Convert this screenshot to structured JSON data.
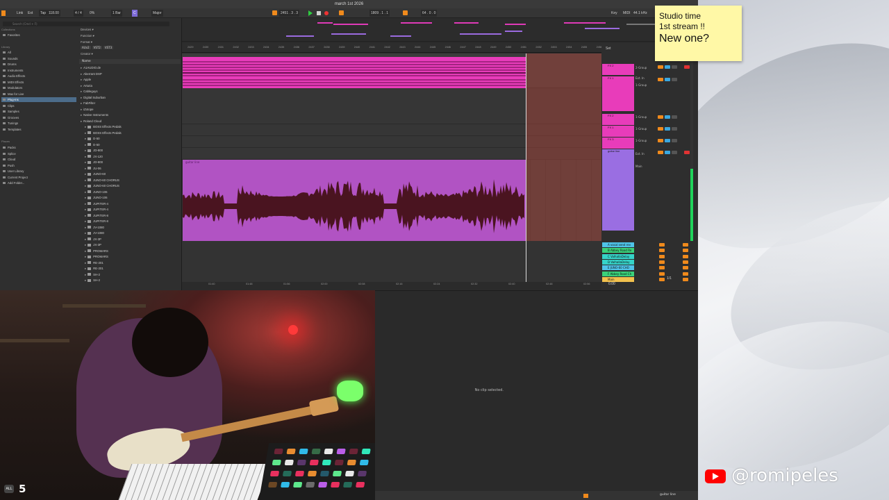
{
  "window": {
    "title": "march 1st 2026"
  },
  "controlbar": {
    "link": "Link",
    "ext": "Ext",
    "tap": "Tap",
    "tempo": "118.00",
    "sig": "4 / 4",
    "cpu": "0%",
    "quant": "1 Bar",
    "key": "C",
    "scale": "Major",
    "position": "2451 . 3 . 3",
    "loop_start": "1809 . 1 . 1",
    "loop_len": "64 . 0 . 0",
    "key_btn": "Key",
    "midi": "MIDI",
    "samplerate": "44.1 kHz"
  },
  "browser": {
    "search_placeholder": "Search (Cmd + F)",
    "collections_label": "Collections",
    "favorites": "Favorites",
    "library_label": "Library",
    "categories": [
      "All",
      "Sounds",
      "Drums",
      "Instruments",
      "Audio Effects",
      "MIDI Effects",
      "Modulators",
      "Max for Live",
      "Plug-Ins",
      "Clips",
      "Samples",
      "Grooves",
      "Tunings",
      "Templates"
    ],
    "places_label": "Places",
    "places": [
      "Packs",
      "Splice",
      "Cloud",
      "Push",
      "User Library",
      "Current Project",
      "Add Folder..."
    ],
    "filters": [
      "Devices ▾",
      "Function ▾",
      "Format ▾"
    ],
    "formats": [
      "AUv2",
      "VST2",
      "VST3"
    ],
    "creator": "Creator ▾",
    "name_header": "Name",
    "vendors": [
      "A1AUDIO.de",
      "Aberrant DSP",
      "Apple",
      "Arturia",
      "Cableguys",
      "Digital Suburban",
      "FabFilter",
      "iZotope",
      "Native Instruments",
      "Roland Cloud"
    ],
    "roland": [
      "BOSS Effects Pedals",
      "BOSS Effects Pedals",
      "D-50",
      "D-50",
      "JD-800",
      "JX-120",
      "JD-800",
      "JU-06",
      "JUNO-60",
      "JUNO-60 CHORUS",
      "JUNO-60 CHORUS",
      "JUNO-106",
      "JUNO-106",
      "JUPITER-4",
      "JUPITER-4",
      "JUPITER-8",
      "JUPITER-8",
      "JV-1080",
      "JV-1080",
      "JX-3P",
      "JX-3P",
      "PROMARS",
      "PROMARS",
      "RE-201",
      "RE-201",
      "SH-2",
      "SH-2"
    ]
  },
  "ruler": [
    "2429",
    "2430",
    "2431",
    "2432",
    "2433",
    "2434",
    "2435",
    "2436",
    "2437",
    "2438",
    "2439",
    "2440",
    "2441",
    "2442",
    "2443",
    "2444",
    "2445",
    "2446",
    "2447",
    "2448",
    "2449",
    "2450",
    "2451",
    "2452",
    "2453",
    "2454",
    "2455",
    "2456"
  ],
  "timeline": [
    "01:40",
    "01:48",
    "01:56",
    "02:00",
    "02:08",
    "02:16",
    "02:24",
    "02:32",
    "02:40",
    "02:48",
    "02:56"
  ],
  "arrangement": {
    "clip_label": "guitar line",
    "set_label": "Set"
  },
  "mixer": {
    "tracks": [
      {
        "name": "FX 2",
        "color": "#e83cba"
      },
      {
        "name": "FX 1",
        "color": "#e83cba"
      },
      {
        "name": "FX 2",
        "color": "#e83cba"
      },
      {
        "name": "FX 1",
        "color": "#e83cba"
      },
      {
        "name": "FX 3",
        "color": "#e83cba"
      },
      {
        "name": "guitar line",
        "color": "#9a6ee2"
      }
    ],
    "io_labels": [
      "2-Group",
      "Ext. In",
      "1-Group",
      "1-Group",
      "1-Group",
      "1-Group",
      "Ext. In",
      "Main"
    ],
    "returns": [
      {
        "name": "A vocal send rev",
        "color": "#4fc3e8"
      },
      {
        "name": "B Abbey Road Re",
        "color": "#3ad17a"
      },
      {
        "name": "C ValhallaDelay",
        "color": "#35d3c8"
      },
      {
        "name": "D ValhallaDelay",
        "color": "#35d3c8"
      },
      {
        "name": "E JUNO-60 CHO",
        "color": "#4fc3e8"
      },
      {
        "name": "F Abbey Road Ch",
        "color": "#3ad17a"
      },
      {
        "name": "Main",
        "color": "#f2c14e"
      }
    ],
    "page": "1/1",
    "main_vol": "0.00"
  },
  "note": {
    "line1": "Studio time",
    "line2": "1st stream !!",
    "line3": "New one?"
  },
  "detail": {
    "empty_text": "No clip selected."
  },
  "statusbar": {
    "track": "guitar line"
  },
  "webcam": {
    "badge": "ALL",
    "viewers": "5"
  },
  "youtube": {
    "handle": "@romipeles"
  },
  "colors": {
    "accent": "#f08a1c",
    "pink_clip": "#e83cba",
    "violet_clip": "#b153c3",
    "meter": "#1fd35a"
  }
}
